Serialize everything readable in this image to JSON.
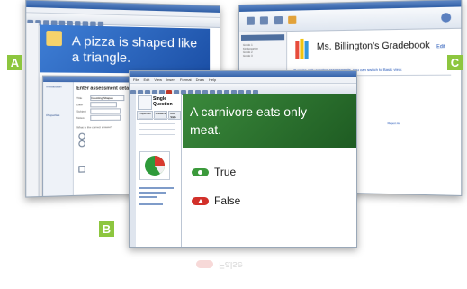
{
  "labels": {
    "a": "A",
    "b": "B",
    "c": "C"
  },
  "window_a": {
    "title": "",
    "slide_text": "A pizza is shaped like a triangle.",
    "dialog": {
      "heading": "Enter assessment details",
      "fields": [
        {
          "label": "Title",
          "value": "Counting Shapes"
        },
        {
          "label": "Date",
          "value": ""
        },
        {
          "label": "Subject",
          "value": ""
        },
        {
          "label": "Notes",
          "value": ""
        }
      ],
      "sidebar_sections": [
        "Introduction",
        "Properties"
      ],
      "question_label": "What is the correct answer?"
    }
  },
  "window_b": {
    "title": "",
    "menu": [
      "File",
      "Edit",
      "View",
      "Insert",
      "Format",
      "Draw",
      "Help"
    ],
    "question_type": "Single Question",
    "tabs": [
      "Properties",
      "Answers",
      "Add Slide"
    ],
    "slide_text": "A carnivore eats only meat.",
    "choices": [
      {
        "label": "True",
        "color": "#3b9a3b",
        "icon": "circle-icon"
      },
      {
        "label": "False",
        "color": "#d2302a",
        "icon": "triangle-icon"
      }
    ],
    "reflection_text": "False"
  },
  "window_c": {
    "title": "",
    "gradebook_title": "Ms. Billington's Gradebook",
    "edit_link": "Edit",
    "subtitle": "",
    "info_line": "If you're only running assessments, you can switch to Basic view.",
    "sidebar_items": [
      "Grade 1",
      "Kindergarten",
      "Grade 2",
      "Grade 3"
    ],
    "report_link": "Report As"
  },
  "colors": {
    "label_green": "#8dc63f",
    "slide_blue": "#2c63bb",
    "slide_green": "#2f7a33"
  }
}
